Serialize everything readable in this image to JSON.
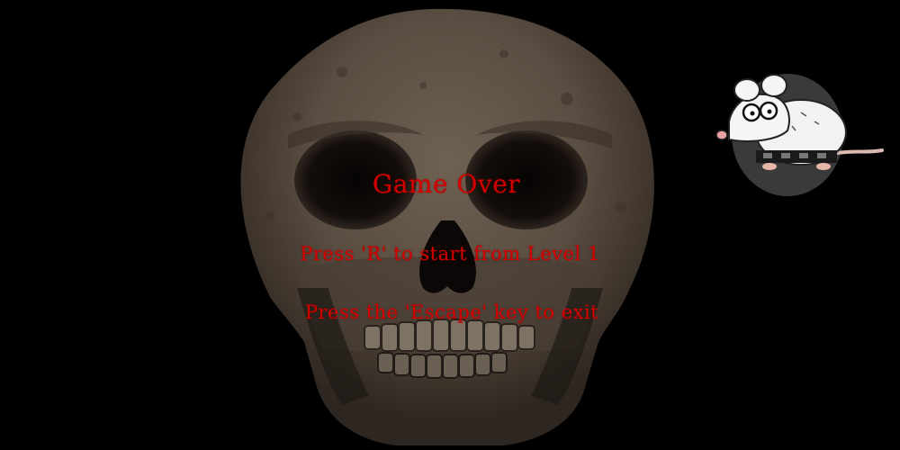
{
  "game": {
    "title": "Game Over",
    "restart_hint": "Press 'R' to start from Level 1",
    "exit_hint": "Press the 'Escape' key to exit"
  },
  "colors": {
    "background": "#000000",
    "text": "#d40000",
    "bone": "#6b5c4e"
  },
  "icons": {
    "background_art": "skull-icon",
    "mascot": "rat-icon"
  }
}
